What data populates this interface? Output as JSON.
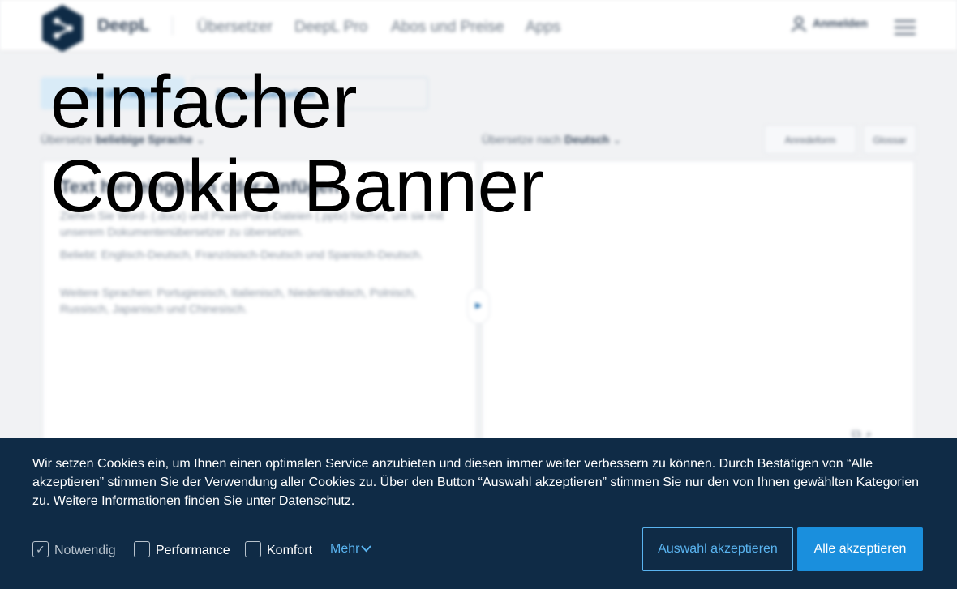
{
  "overlay": {
    "line1": "einfacher",
    "line2": "Cookie Banner"
  },
  "header": {
    "brand": "DeepL",
    "nav": [
      "Übersetzer",
      "DeepL Pro",
      "Abos und Preise",
      "Apps"
    ],
    "login": "Anmelden"
  },
  "tabs": {
    "text": "Text übersetzen",
    "files": "Dateien übersetzen"
  },
  "source": {
    "label": "Übersetze",
    "lang": "beliebige Sprache",
    "heading": "Text hier eingeben oder einfügen",
    "p1": "Ziehen Sie Word- (.docx) und PowerPoint-Dateien (.pptx) hierher, um sie mit unserem Dokumentenübersetzer zu übersetzen.",
    "p2": "Beliebt: Englisch-Deutsch, Französisch-Deutsch und Spanisch-Deutsch.",
    "p3": "Weitere Sprachen: Portugiesisch, Italienisch, Niederländisch, Polnisch, Russisch, Japanisch und Chinesisch."
  },
  "target": {
    "label": "Übersetze nach",
    "lang": "Deutsch",
    "formality": "Anredeform",
    "glossary": "Glossar"
  },
  "cookie": {
    "text_before": "Wir setzen Cookies ein, um Ihnen einen optimalen Service anzubieten und diesen immer weiter verbessern zu können. Durch Bestätigen von “Alle akzeptieren” stimmen Sie der Verwendung aller Cookies zu. Über den Button “Auswahl akzeptieren” stimmen Sie nur den von Ihnen gewählten Kategorien zu. Weitere Informationen finden Sie unter ",
    "link": "Datenschutz",
    "text_after": ".",
    "options": [
      {
        "label": "Notwendig",
        "checked": true,
        "disabled": true
      },
      {
        "label": "Performance",
        "checked": false,
        "disabled": false
      },
      {
        "label": "Komfort",
        "checked": false,
        "disabled": false
      }
    ],
    "more": "Mehr",
    "accept_selection": "Auswahl akzeptieren",
    "accept_all": "Alle akzeptieren"
  },
  "colors": {
    "banner_bg": "#0f2b46",
    "accent": "#1a8fdd",
    "link_accent": "#5ab4f0"
  },
  "icons": [
    "deepl-logo-icon",
    "user-icon",
    "hamburger-menu-icon",
    "chevron-down-icon",
    "swap-arrow-icon",
    "checkmark-icon"
  ]
}
